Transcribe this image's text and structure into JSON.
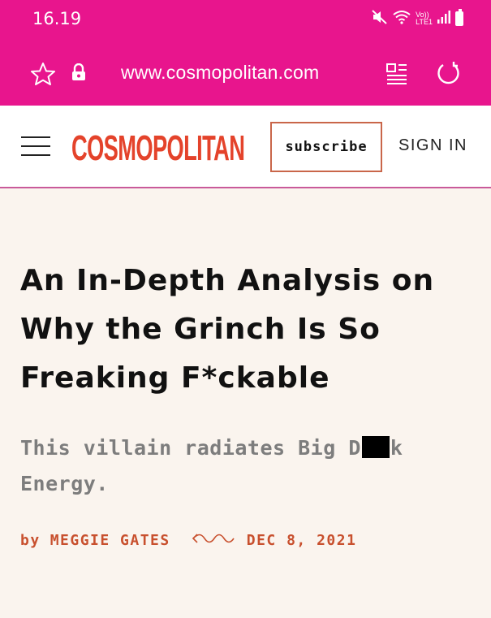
{
  "status_bar": {
    "time": "16.19",
    "network_label": "Vo))\nLTE1"
  },
  "browser": {
    "url": "www.cosmopolitan.com",
    "icons": [
      "star-icon",
      "lock-icon",
      "reader-mode-icon",
      "refresh-icon"
    ]
  },
  "header": {
    "logo": "COSMOPOLITAN",
    "subscribe_label": "subscribe",
    "signin_label": "SIGN IN"
  },
  "article": {
    "headline": "An In-Depth Analysis on Why the Grinch Is So Freaking F*ckable",
    "dek_before": "This villain radiates Big D",
    "dek_after": "k Energy.",
    "byline_prefix": "by",
    "author": "MEGGIE GATES",
    "date": "DEC 8, 2021"
  },
  "colors": {
    "browser_bar": "#e8158d",
    "logo": "#e4432b",
    "byline": "#c8502e",
    "page_bg": "#faf4ee"
  }
}
